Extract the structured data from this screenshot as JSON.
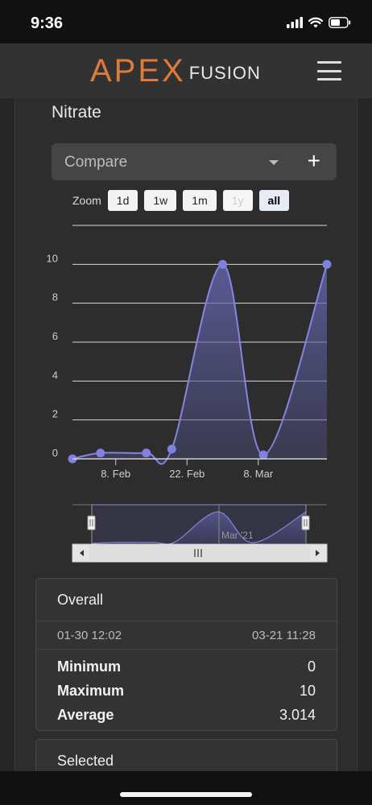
{
  "status_bar": {
    "time": "9:36"
  },
  "header": {
    "logo_main": "APEX",
    "logo_sub": "FUSION"
  },
  "page": {
    "title": "Nitrate"
  },
  "compare": {
    "label": "Compare",
    "add": "+"
  },
  "zoom": {
    "label": "Zoom",
    "options": [
      {
        "label": "1d",
        "state": "normal"
      },
      {
        "label": "1w",
        "state": "normal"
      },
      {
        "label": "1m",
        "state": "normal"
      },
      {
        "label": "1y",
        "state": "disabled"
      },
      {
        "label": "all",
        "state": "active"
      }
    ]
  },
  "chart_data": {
    "type": "area",
    "title": "",
    "xlabel": "",
    "ylabel": "",
    "x_tick_labels": [
      "8. Feb",
      "22. Feb",
      "8. Mar"
    ],
    "y_ticks": [
      0,
      2,
      4,
      6,
      8,
      10
    ],
    "ylim": [
      0,
      12
    ],
    "grid": true,
    "colors": {
      "line": "#7f7fdc",
      "fill": "#5a5aa0"
    },
    "series": [
      {
        "points": [
          {
            "x": "01-30 12:02",
            "y": 0
          },
          {
            "x": "02-05",
            "y": 0.3
          },
          {
            "x": "02-14",
            "y": 0.3
          },
          {
            "x": "02-19",
            "y": 0.5
          },
          {
            "x": "03-01",
            "y": 10
          },
          {
            "x": "03-09",
            "y": 0.2
          },
          {
            "x": "03-21 11:28",
            "y": 10
          }
        ]
      }
    ],
    "navigator": {
      "label": "Mar '21"
    }
  },
  "overall": {
    "title": "Overall",
    "start": "01-30 12:02",
    "end": "03-21 11:28",
    "stats": [
      {
        "label": "Minimum",
        "value": "0"
      },
      {
        "label": "Maximum",
        "value": "10"
      },
      {
        "label": "Average",
        "value": "3.014"
      }
    ]
  },
  "selected": {
    "title": "Selected"
  }
}
